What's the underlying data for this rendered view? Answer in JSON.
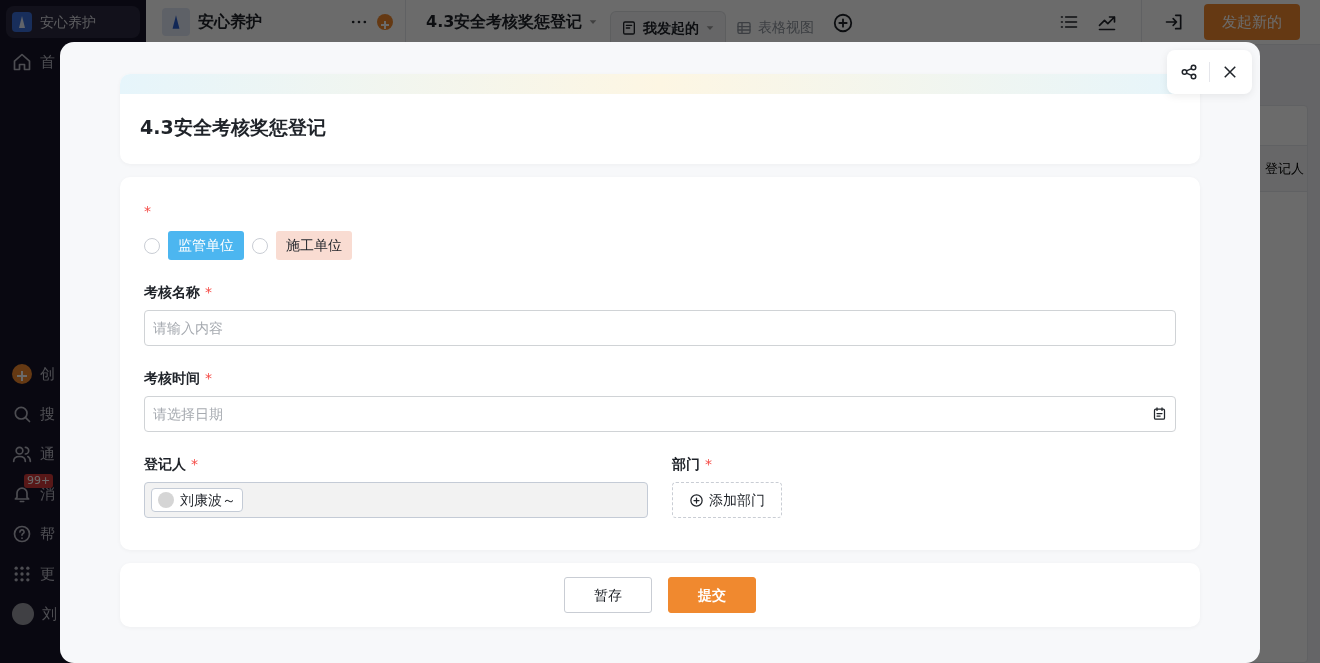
{
  "sidebar": {
    "brand": "安心养护",
    "items": [
      {
        "label": "首"
      },
      {
        "label": "创"
      },
      {
        "label": "搜"
      },
      {
        "label": "通"
      },
      {
        "label": "消",
        "badge": "99+"
      },
      {
        "label": "帮"
      },
      {
        "label": "更"
      },
      {
        "label": "刘"
      }
    ]
  },
  "header": {
    "app_name": "安心养护",
    "form_title": "4.3安全考核奖惩登记",
    "views": [
      {
        "label": "我发起的",
        "selected": true
      },
      {
        "label": "表格视图",
        "selected": false
      }
    ],
    "primary_button": "发起新的"
  },
  "background_table": {
    "columns": [
      "登记人"
    ]
  },
  "modal": {
    "title": "4.3安全考核奖惩登记",
    "rows": [
      [
        {
          "kind": "radio",
          "mark": "*",
          "options": [
            {
              "label": "监管单位",
              "color": "#4cb6f0",
              "selected": false
            },
            {
              "label": "施工单位",
              "color": "#f9dcd2",
              "selected": false
            }
          ]
        }
      ],
      [
        {
          "kind": "text",
          "label": "考核名称",
          "mark": "*",
          "placeholder": "请输入内容"
        }
      ],
      [
        {
          "kind": "date",
          "label": "考核时间",
          "mark": "*",
          "placeholder": "请选择日期"
        }
      ],
      [
        {
          "kind": "users",
          "label": "登记人",
          "mark": "*",
          "users": [
            {
              "name": "刘康波～"
            }
          ]
        },
        {
          "kind": "department",
          "label": "部门",
          "mark": "*",
          "button": "添加部门"
        }
      ]
    ],
    "buttons": [
      {
        "label": "暂存",
        "kind": "secondary"
      },
      {
        "label": "提交",
        "kind": "primary"
      }
    ]
  }
}
